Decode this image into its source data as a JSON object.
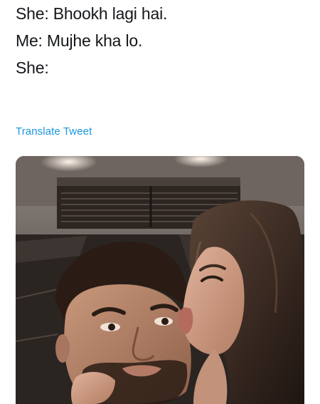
{
  "tweet": {
    "lines": [
      "She: Bhookh lagi hai.",
      "Me: Mujhe kha lo.",
      "She:"
    ],
    "translate_label": "Translate Tweet"
  },
  "media": {
    "icon": "photo-image"
  },
  "colors": {
    "text": "#14171a",
    "link": "#1b95e0",
    "background": "#ffffff"
  }
}
